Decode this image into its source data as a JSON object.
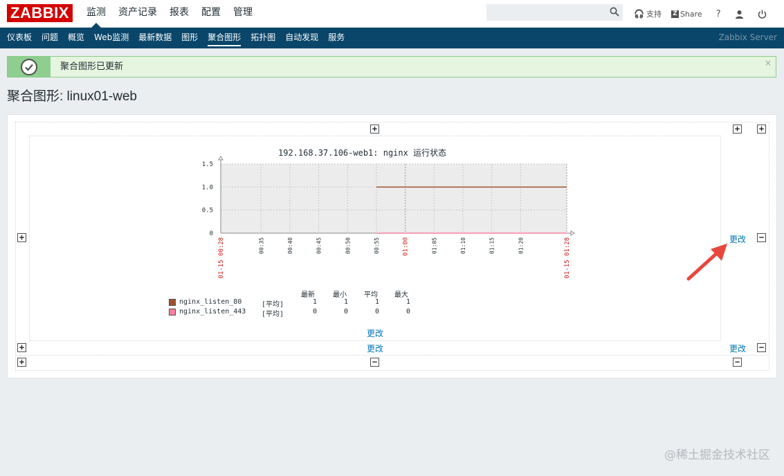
{
  "header": {
    "logo": "ZABBIX",
    "menu": [
      {
        "label": "监测",
        "active": true
      },
      {
        "label": "资产记录",
        "active": false
      },
      {
        "label": "报表",
        "active": false
      },
      {
        "label": "配置",
        "active": false
      },
      {
        "label": "管理",
        "active": false
      }
    ],
    "search_placeholder": "",
    "support_label": "支持",
    "share_label": "Share",
    "help_label": "?"
  },
  "submenu": {
    "items": [
      {
        "label": "仪表板",
        "active": false
      },
      {
        "label": "问题",
        "active": false
      },
      {
        "label": "概览",
        "active": false
      },
      {
        "label": "Web监测",
        "active": false
      },
      {
        "label": "最新数据",
        "active": false
      },
      {
        "label": "图形",
        "active": false
      },
      {
        "label": "聚合图形",
        "active": true
      },
      {
        "label": "拓扑图",
        "active": false
      },
      {
        "label": "自动发现",
        "active": false
      },
      {
        "label": "服务",
        "active": false
      }
    ],
    "server_name": "Zabbix Server"
  },
  "message": {
    "text": "聚合图形已更新",
    "close": "×"
  },
  "page_title": "聚合图形: linux01-web",
  "screen": {
    "change_label": "更改",
    "graph_title": "192.168.37.106-web1: nginx 运行状态"
  },
  "chart_data": {
    "type": "line",
    "title": "192.168.37.106-web1: nginx 运行状态",
    "ylim": [
      0,
      1.5
    ],
    "yticks": [
      "0",
      "0.5",
      "1.0",
      "1.5"
    ],
    "xticks": [
      "01-15 00:28",
      "00:35",
      "00:40",
      "00:45",
      "00:50",
      "00:55",
      "01:00",
      "01:05",
      "01:10",
      "01:15",
      "01:20",
      "01-15 01:28"
    ],
    "xtick_red": [
      true,
      false,
      false,
      false,
      false,
      false,
      true,
      false,
      false,
      false,
      false,
      true
    ],
    "series": [
      {
        "name": "nginx_listen_80",
        "color": "#a0522d",
        "func": "[平均]",
        "start": "00:55",
        "end": "01:28",
        "value": 1,
        "last": "1",
        "min": "1",
        "avg": "1",
        "max": "1"
      },
      {
        "name": "nginx_listen_443",
        "color": "#ff80a0",
        "func": "[平均]",
        "start": "00:55",
        "end": "01:28",
        "value": 0,
        "last": "0",
        "min": "0",
        "avg": "0",
        "max": "0"
      }
    ],
    "legend_headers": [
      "最新",
      "最小",
      "平均",
      "最大"
    ]
  },
  "watermark": "@稀土掘金技术社区"
}
